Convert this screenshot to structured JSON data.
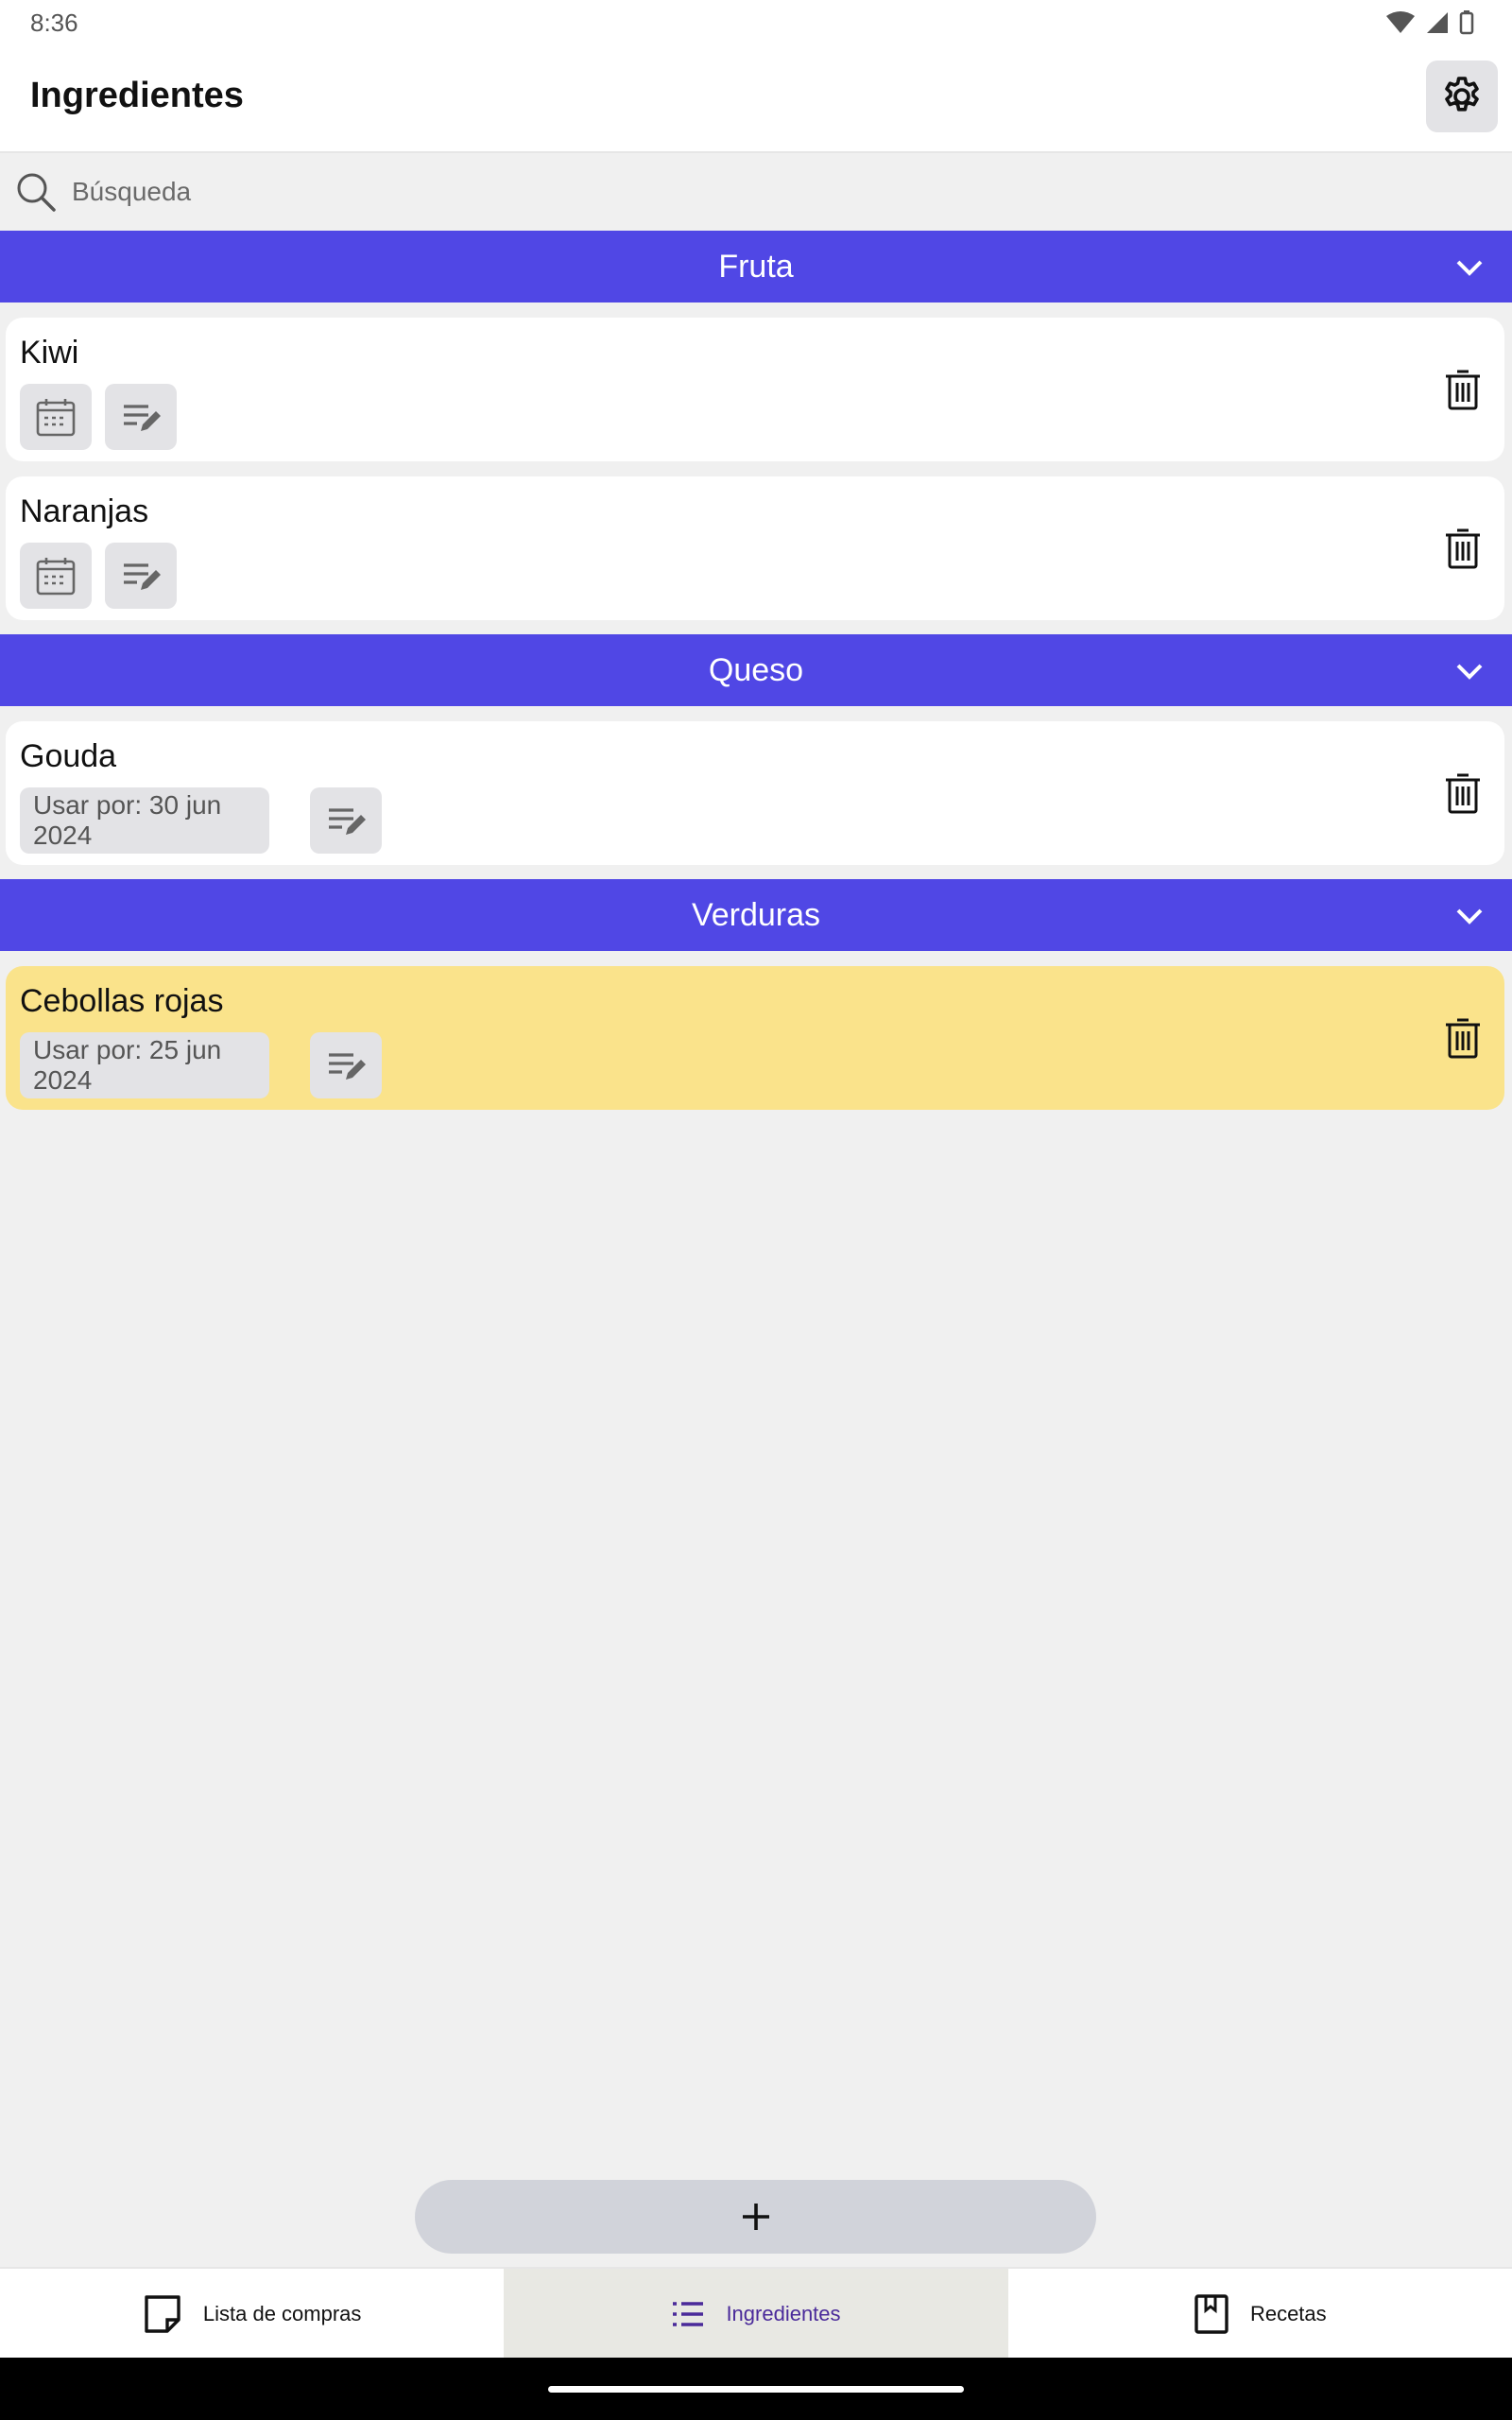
{
  "status": {
    "time": "8:36"
  },
  "app": {
    "title": "Ingredientes"
  },
  "search": {
    "placeholder": "Búsqueda"
  },
  "categories": [
    {
      "name": "Fruta",
      "items": [
        {
          "name": "Kiwi",
          "expiry": ""
        },
        {
          "name": "Naranjas",
          "expiry": ""
        }
      ]
    },
    {
      "name": "Queso",
      "items": [
        {
          "name": "Gouda",
          "expiry": "Usar por: 30 jun 2024"
        }
      ]
    },
    {
      "name": "Verduras",
      "items": [
        {
          "name": "Cebollas rojas",
          "expiry": "Usar por: 25 jun 2024",
          "highlight": true
        }
      ]
    }
  ],
  "fab": {
    "symbol": "+"
  },
  "nav": {
    "tabs": [
      {
        "label": "Lista de compras"
      },
      {
        "label": "Ingredientes",
        "active": true
      },
      {
        "label": "Recetas"
      }
    ]
  },
  "colors": {
    "category_header": "#5047e5",
    "highlight_card": "#fae38b",
    "active_tab_text": "#4a2a9a"
  }
}
